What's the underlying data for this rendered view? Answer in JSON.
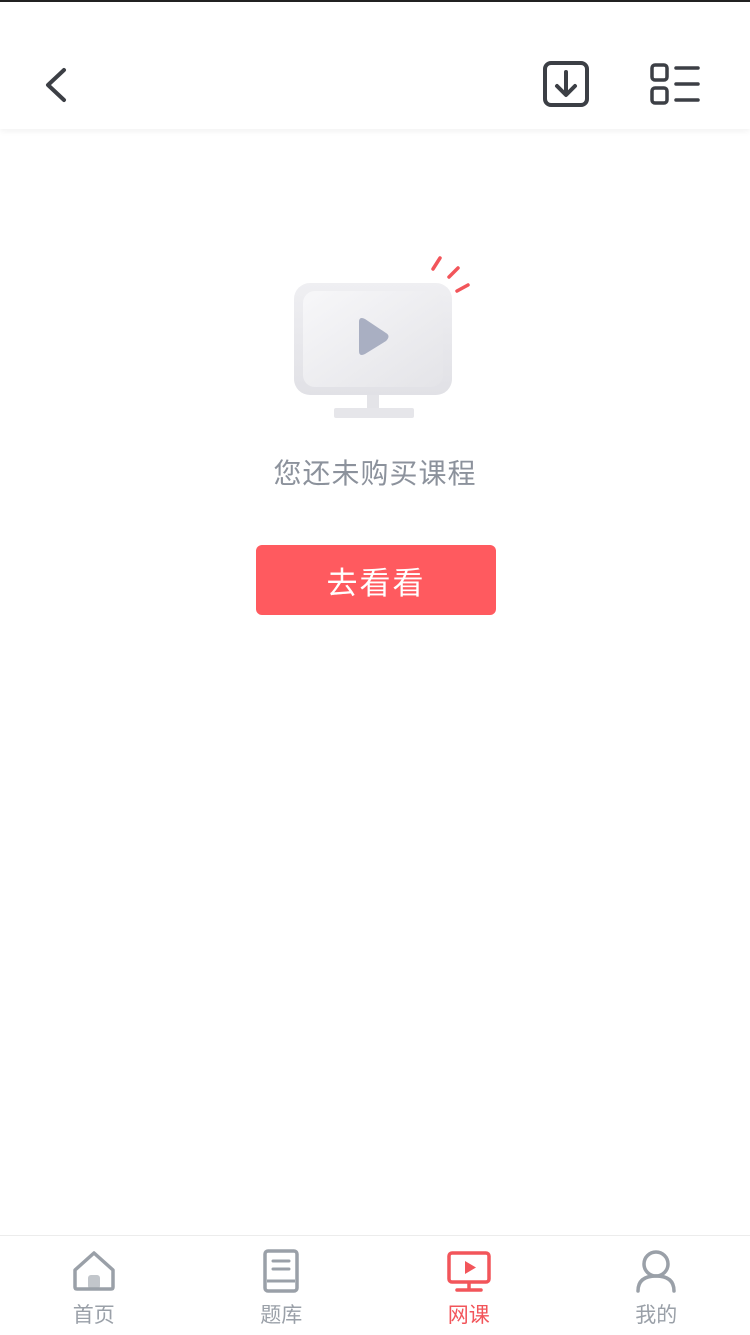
{
  "header": {
    "back_icon": "chevron-left-icon",
    "download_icon": "download-icon",
    "menu_icon": "list-grid-icon"
  },
  "empty_state": {
    "illustration_icon": "tv-play-icon",
    "message": "您还未购买课程",
    "action_label": "去看看"
  },
  "tabbar": {
    "items": [
      {
        "label": "首页",
        "icon": "home-icon",
        "active": false
      },
      {
        "label": "题库",
        "icon": "book-icon",
        "active": false
      },
      {
        "label": "网课",
        "icon": "video-course-icon",
        "active": true
      },
      {
        "label": "我的",
        "icon": "user-icon",
        "active": false
      }
    ]
  },
  "colors": {
    "accent": "#ff5a5f",
    "icon_dark": "#3c3f45",
    "inactive": "#9aa0a8"
  }
}
